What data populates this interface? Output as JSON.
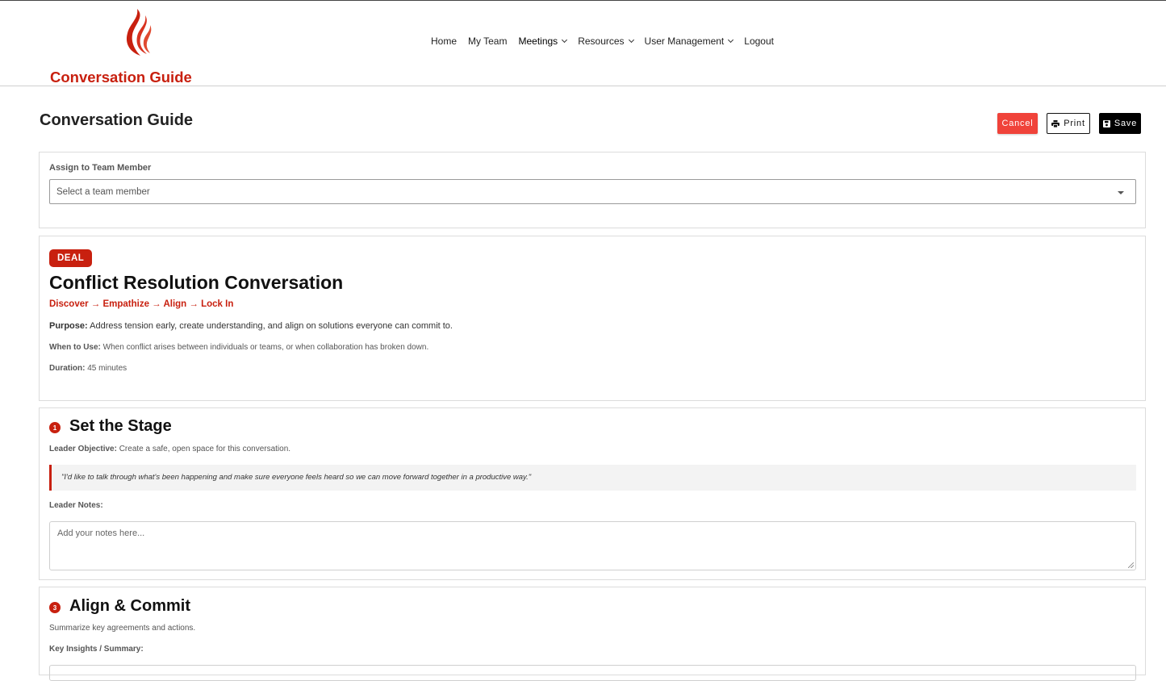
{
  "brand": {
    "name": "Conversation Guide",
    "accent": "#c8200f"
  },
  "nav": {
    "items": [
      {
        "label": "Home",
        "dropdown": false
      },
      {
        "label": "My Team",
        "dropdown": false
      },
      {
        "label": "Meetings",
        "dropdown": true
      },
      {
        "label": "Resources",
        "dropdown": true
      },
      {
        "label": "User Management",
        "dropdown": true
      },
      {
        "label": "Logout",
        "dropdown": false
      }
    ]
  },
  "page": {
    "title": "Conversation Guide",
    "actions": {
      "cancel": "Cancel",
      "print": "Print",
      "save": "Save"
    }
  },
  "assign": {
    "label": "Assign to Team Member",
    "placeholder": "Select a team member"
  },
  "guide": {
    "badge": "DEAL",
    "title": "Conflict Resolution Conversation",
    "flow": "Discover → Empathize → Align → Lock In",
    "purpose_label": "Purpose:",
    "purpose": "Address tension early, create understanding, and align on solutions everyone can commit to.",
    "when_label": "When to Use:",
    "when": "When conflict arises between individuals or teams, or when collaboration has broken down.",
    "duration_label": "Duration:",
    "duration": "45 minutes"
  },
  "sections": [
    {
      "number": "1",
      "title": "Set the Stage",
      "objective_label": "Leader Objective:",
      "objective": "Create a safe, open space for this conversation.",
      "quote": "\"I'd like to talk through what's been happening and make sure everyone feels heard so we can move forward together in a productive way.\"",
      "notes_label": "Leader Notes:",
      "notes_placeholder": "Add your notes here..."
    },
    {
      "number": "3",
      "title": "Align & Commit",
      "description": "Summarize key agreements and actions.",
      "summary_label": "Key Insights / Summary:"
    }
  ]
}
